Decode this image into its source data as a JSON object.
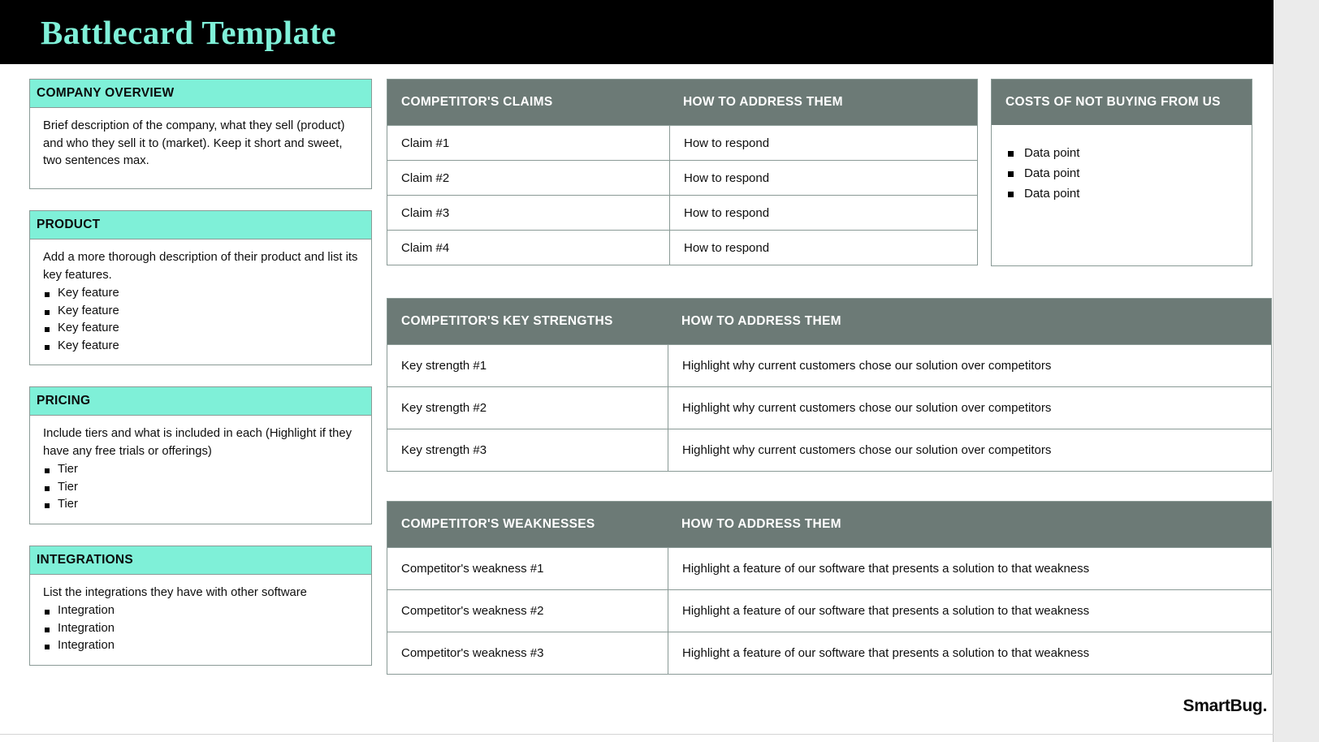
{
  "header": {
    "title": "Battlecard Template",
    "bar_color": "#000000",
    "title_color": "#7ff0d8"
  },
  "theme": {
    "accent_teal": "#7ff0d8",
    "header_gray": "#6c7a76",
    "border_gray": "#8a9a96",
    "text_black": "#0e0e0e"
  },
  "left_column": {
    "cards": [
      {
        "heading": "COMPANY OVERVIEW",
        "paragraph": "Brief description of the company, what they sell (product) and who they sell it to (market). Keep it short and sweet, two sentences max.",
        "bullets": []
      },
      {
        "heading": "PRODUCT",
        "paragraph": "Add a more thorough description of their product and list its key features.",
        "bullets": [
          "Key feature",
          "Key feature",
          "Key feature",
          "Key feature"
        ]
      },
      {
        "heading": "PRICING",
        "paragraph": "Include tiers and what is included in each (Highlight if they have any free trials or offerings)",
        "bullets": [
          "Tier",
          "Tier",
          "Tier"
        ]
      },
      {
        "heading": "INTEGRATIONS",
        "paragraph": "List the integrations they have with other software",
        "bullets": [
          "Integration",
          "Integration",
          "Integration"
        ]
      }
    ]
  },
  "claims_table": {
    "columns": [
      "COMPETITOR'S CLAIMS",
      "HOW TO ADDRESS THEM"
    ],
    "rows": [
      [
        "Claim #1",
        "How to respond"
      ],
      [
        "Claim #2",
        "How to respond"
      ],
      [
        "Claim #3",
        "How to respond"
      ],
      [
        "Claim #4",
        "How to respond"
      ]
    ]
  },
  "costs_panel": {
    "heading": "COSTS OF NOT BUYING FROM US",
    "bullets": [
      "Data point",
      "Data point",
      "Data point"
    ]
  },
  "strengths_table": {
    "columns": [
      "COMPETITOR'S KEY STRENGTHS",
      "HOW TO ADDRESS THEM"
    ],
    "rows": [
      [
        "Key strength #1",
        "Highlight why current customers chose our solution over competitors"
      ],
      [
        "Key strength #2",
        "Highlight why current  customers chose our solution over competitors"
      ],
      [
        "Key strength #3",
        "Highlight why current  customers chose our solution over competitors"
      ]
    ]
  },
  "weaknesses_table": {
    "columns": [
      "COMPETITOR'S WEAKNESSES",
      "HOW TO ADDRESS THEM"
    ],
    "rows": [
      [
        "Competitor's weakness #1",
        "Highlight a feature of our software that presents a solution to that weakness"
      ],
      [
        "Competitor's weakness #2",
        "Highlight a feature of our software that presents a solution to that weakness"
      ],
      [
        "Competitor's weakness #3",
        "Highlight a feature of our software that presents a solution to that weakness"
      ]
    ]
  },
  "footer": {
    "logo_text": "SmartBug."
  }
}
